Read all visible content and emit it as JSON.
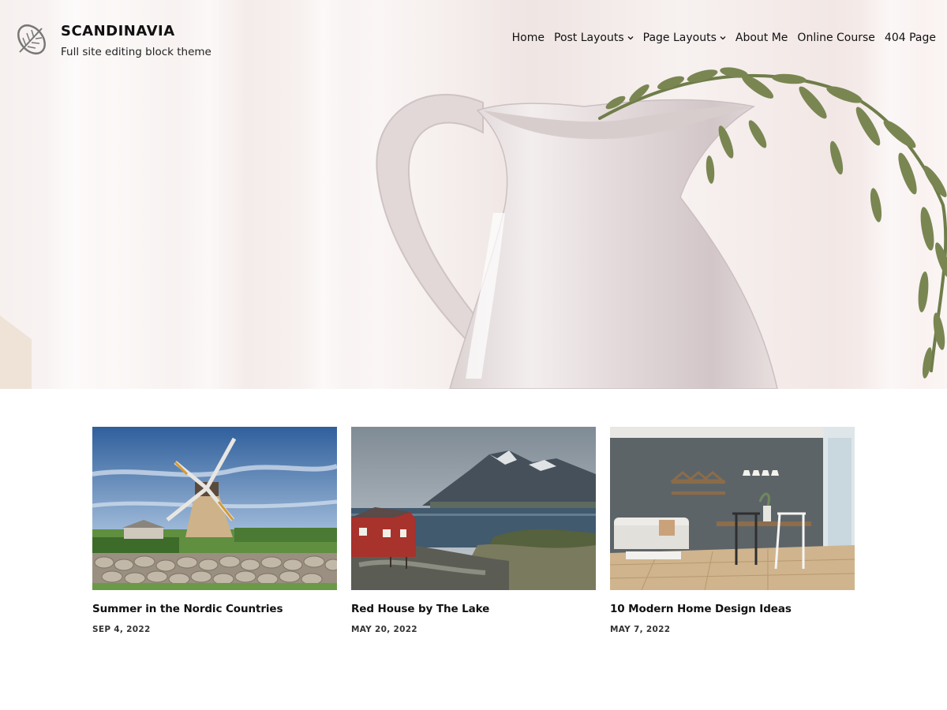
{
  "site": {
    "title": "SCANDINAVIA",
    "tagline": "Full site editing block theme",
    "logo_icon": "leaf-icon"
  },
  "nav": {
    "items": [
      {
        "label": "Home",
        "has_dropdown": false
      },
      {
        "label": "Post Layouts",
        "has_dropdown": true
      },
      {
        "label": "Page Layouts",
        "has_dropdown": true
      },
      {
        "label": "About Me",
        "has_dropdown": false
      },
      {
        "label": "Online Course",
        "has_dropdown": false
      },
      {
        "label": "404 Page",
        "has_dropdown": false
      }
    ]
  },
  "hero": {
    "image": "white-pitcher-with-evergreen-branch"
  },
  "posts": [
    {
      "title": "Summer in the Nordic Countries",
      "date": "SEP 4, 2022",
      "image": "windmill"
    },
    {
      "title": "Red House by The Lake",
      "date": "MAY 20, 2022",
      "image": "red-house-lake"
    },
    {
      "title": "10 Modern Home Design Ideas",
      "date": "MAY 7, 2022",
      "image": "modern-living-room"
    }
  ],
  "colors": {
    "text": "#111111",
    "background": "#ffffff",
    "hero_tint": "#f4ecea",
    "branch_green": "#6f7d4a"
  }
}
